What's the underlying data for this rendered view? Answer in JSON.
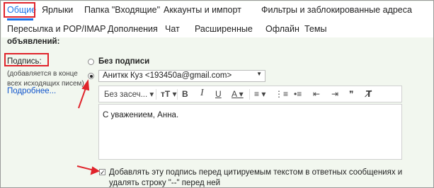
{
  "tabs_row1": [
    {
      "label": "Общие",
      "active": true
    },
    {
      "label": "Ярлыки",
      "active": false
    },
    {
      "label": "Папка \"Входящие\"",
      "active": false
    },
    {
      "label": "Аккаунты и импорт",
      "active": false
    },
    {
      "label": "Фильтры и заблокированные адреса",
      "active": false
    }
  ],
  "tabs_row2": [
    {
      "label": "Пересылка и POP/IMAP"
    },
    {
      "label": "Дополнения"
    },
    {
      "label": "Чат"
    },
    {
      "label": "Расширенные"
    },
    {
      "label": "Офлайн"
    },
    {
      "label": "Темы"
    }
  ],
  "cut_text": "объявлений:",
  "signature": {
    "label": "Подпись:",
    "note": "(добавляется в конце всех исходящих писем)",
    "learn_more": "Подробнее...",
    "no_signature_label": "Без подписи",
    "no_signature_checked": false,
    "account_selected": true,
    "account_value": "Аниткк Куз <193450a@gmail.com>",
    "toolbar": {
      "font_label": "Без засеч...",
      "icons": [
        "font-size-icon",
        "bold-icon",
        "italic-icon",
        "underline-icon",
        "text-color-icon",
        "align-icon",
        "numbered-list-icon",
        "bulleted-list-icon",
        "indent-less-icon",
        "indent-more-icon",
        "remove-formatting-icon"
      ]
    },
    "text": "С уважением, Анна.",
    "append_before_quote": true,
    "append_label": "Добавлять эту подпись перед цитируемым текстом в ответных сообщениях и удалять строку \"--\" перед ней"
  },
  "colors": {
    "accent": "#1a73e8",
    "highlight": "#e0242b",
    "background": "#f2f7ef",
    "link": "#1155cc"
  }
}
